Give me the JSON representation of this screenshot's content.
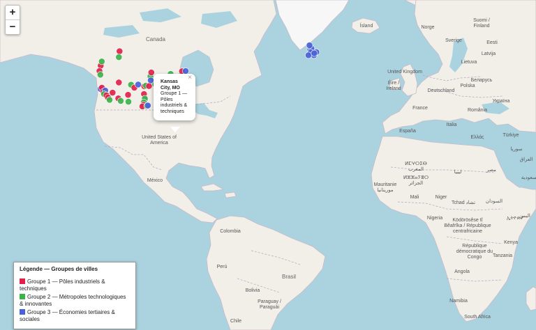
{
  "zoom": {
    "in_label": "+",
    "out_label": "−"
  },
  "popup": {
    "title": "Kansas City, MO",
    "body": "Groupe 1 — Pôles industriels & techniques",
    "close_label": "×"
  },
  "legend": {
    "title": "Légende — Groupes de villes",
    "items": [
      {
        "label": "Groupe 1 — Pôles industriels & techniques",
        "color": "#e0224b"
      },
      {
        "label": "Groupe 2 — Métropoles technologiques & innovantes",
        "color": "#3cb34a"
      },
      {
        "label": "Groupe 3 — Économies tertiaires & sociales",
        "color": "#4a62d8"
      }
    ]
  },
  "colors": {
    "ocean": "#aad3df",
    "land": "#f2efe9"
  },
  "places": {
    "canada": "Canada",
    "usa": "United States of America",
    "mexico": "México",
    "colombia": "Colombia",
    "peru": "Perú",
    "brasil": "Brasil",
    "bolivia": "Bolivia",
    "paraguay": "Paraguay / Paraguái",
    "chile": "Chile",
    "island": "Ísland",
    "uk": "United Kingdom",
    "ireland": "Éire / Ireland",
    "norge": "Norge",
    "sverige": "Sverige",
    "suomi": "Suomi / Finland",
    "eesti": "Eesti",
    "latvija": "Latvija",
    "lietuva": "Lietuva",
    "belarus": "Беларусь",
    "deutschland": "Deutschland",
    "polska": "Polska",
    "ukraina": "Україна",
    "france": "France",
    "romania": "România",
    "espana": "España",
    "italia": "Italia",
    "ellas": "Ελλάς",
    "turkiye": "Türkiye",
    "suriya": "سوريا",
    "iraq": "العراق",
    "maroc": "ⵍⵎⵖⵔⵉⴱ المغرب",
    "algerie": "ⵍⵣⵣⴰⵢⴻⵔ الجزائر",
    "libya": "ليبيا",
    "misr": "مصر",
    "mauritanie": "Mauritanie موريتانيا",
    "mali": "Mali",
    "niger": "Niger",
    "tchad": "Tchad تشاد",
    "sudan": "السودان",
    "ethiopia": "ኢትዮጵያ",
    "nigeria": "Nigeria",
    "car": "Ködörösêse tî Bêafrîka / République centrafricaine",
    "rdc": "République démocratique du Congo",
    "kenya": "Kenya",
    "tanzania": "Tanzania",
    "angola": "Angola",
    "namibia": "Namibia",
    "southafrica": "South Africa",
    "saudi": "السعودية",
    "yemen": "اليمن"
  },
  "markers": [
    {
      "group": 1,
      "lon": -122.3,
      "lat": 47.6
    },
    {
      "group": 1,
      "lon": -123.0,
      "lat": 45.5
    },
    {
      "group": 2,
      "lon": -122.5,
      "lat": 44.0
    },
    {
      "group": 2,
      "lon": -121.7,
      "lat": 49.2
    },
    {
      "group": 3,
      "lon": -122.4,
      "lat": 37.8
    },
    {
      "group": 1,
      "lon": -121.6,
      "lat": 38.4
    },
    {
      "group": 1,
      "lon": -120.8,
      "lat": 36.6
    },
    {
      "group": 3,
      "lon": -119.7,
      "lat": 37.1
    },
    {
      "group": 2,
      "lon": -120.4,
      "lat": 35.5
    },
    {
      "group": 1,
      "lon": -119.0,
      "lat": 34.9
    },
    {
      "group": 1,
      "lon": -118.1,
      "lat": 33.8
    },
    {
      "group": 2,
      "lon": -117.2,
      "lat": 32.7
    },
    {
      "group": 1,
      "lon": -115.5,
      "lat": 36.1
    },
    {
      "group": 1,
      "lon": -111.5,
      "lat": 52.9
    },
    {
      "group": 2,
      "lon": -111.9,
      "lat": 50.8
    },
    {
      "group": 1,
      "lon": -111.9,
      "lat": 40.7
    },
    {
      "group": 1,
      "lon": -112.2,
      "lat": 33.4
    },
    {
      "group": 2,
      "lon": -110.8,
      "lat": 32.2
    },
    {
      "group": 1,
      "lon": -106.6,
      "lat": 35.1
    },
    {
      "group": 2,
      "lon": -104.9,
      "lat": 39.7
    },
    {
      "group": 2,
      "lon": -106.4,
      "lat": 31.8
    },
    {
      "group": 1,
      "lon": -103.0,
      "lat": 38.4
    },
    {
      "group": 3,
      "lon": -100.8,
      "lat": 39.8
    },
    {
      "group": 1,
      "lon": -97.3,
      "lat": 39.0
    },
    {
      "group": 2,
      "lon": -96.4,
      "lat": 39.3
    },
    {
      "group": 1,
      "lon": -94.6,
      "lat": 39.1
    },
    {
      "group": 1,
      "lon": -97.5,
      "lat": 35.5
    },
    {
      "group": 1,
      "lon": -97.3,
      "lat": 32.7
    },
    {
      "group": 3,
      "lon": -96.9,
      "lat": 32.9
    },
    {
      "group": 2,
      "lon": -97.0,
      "lat": 33.3
    },
    {
      "group": 2,
      "lon": -97.6,
      "lat": 31.5
    },
    {
      "group": 1,
      "lon": -97.7,
      "lat": 30.3
    },
    {
      "group": 1,
      "lon": -98.4,
      "lat": 29.5
    },
    {
      "group": 2,
      "lon": -95.8,
      "lat": 29.7
    },
    {
      "group": 3,
      "lon": -95.3,
      "lat": 29.9
    },
    {
      "group": 2,
      "lon": -93.8,
      "lat": 43.3
    },
    {
      "group": 1,
      "lon": -93.3,
      "lat": 44.9
    },
    {
      "group": 3,
      "lon": -93.6,
      "lat": 41.6
    },
    {
      "group": 2,
      "lon": -91.0,
      "lat": 39.8
    },
    {
      "group": 1,
      "lon": -90.2,
      "lat": 38.6
    },
    {
      "group": 1,
      "lon": -89.0,
      "lat": 42.3
    },
    {
      "group": 2,
      "lon": -88.0,
      "lat": 41.8
    },
    {
      "group": 3,
      "lon": -87.9,
      "lat": 43.0
    },
    {
      "group": 1,
      "lon": -86.2,
      "lat": 39.8
    },
    {
      "group": 2,
      "lon": -85.7,
      "lat": 38.3
    },
    {
      "group": 1,
      "lon": -86.8,
      "lat": 36.2
    },
    {
      "group": 3,
      "lon": -88.0,
      "lat": 34.6
    },
    {
      "group": 1,
      "lon": -86.8,
      "lat": 33.5
    },
    {
      "group": 2,
      "lon": -84.4,
      "lat": 33.8
    },
    {
      "group": 1,
      "lon": -84.0,
      "lat": 42.3
    },
    {
      "group": 2,
      "lon": -83.0,
      "lat": 40.0
    },
    {
      "group": 2,
      "lon": -82.2,
      "lat": 44.3
    },
    {
      "group": 1,
      "lon": -81.7,
      "lat": 41.5
    },
    {
      "group": 1,
      "lon": -80.0,
      "lat": 40.4
    },
    {
      "group": 2,
      "lon": -80.8,
      "lat": 35.2
    },
    {
      "group": 1,
      "lon": -79.5,
      "lat": 37.5
    },
    {
      "group": 3,
      "lon": -78.6,
      "lat": 35.8
    },
    {
      "group": 1,
      "lon": -79.9,
      "lat": 32.8
    },
    {
      "group": 2,
      "lon": -81.0,
      "lat": 32.1
    },
    {
      "group": 3,
      "lon": -81.7,
      "lat": 30.3
    },
    {
      "group": 1,
      "lon": -82.5,
      "lat": 28.0
    },
    {
      "group": 1,
      "lon": -81.4,
      "lat": 28.5
    },
    {
      "group": 2,
      "lon": -80.6,
      "lat": 27.0
    },
    {
      "group": 3,
      "lon": -80.2,
      "lat": 25.8
    },
    {
      "group": 1,
      "lon": -77.5,
      "lat": 38.9
    },
    {
      "group": 3,
      "lon": -77.0,
      "lat": 38.9
    },
    {
      "group": 1,
      "lon": -75.2,
      "lat": 40.0
    },
    {
      "group": 2,
      "lon": -74.0,
      "lat": 40.7
    },
    {
      "group": 3,
      "lon": -73.8,
      "lat": 42.7
    },
    {
      "group": 1,
      "lon": -72.7,
      "lat": 41.8
    },
    {
      "group": 3,
      "lon": -71.1,
      "lat": 42.4
    },
    {
      "group": 1,
      "lon": -71.5,
      "lat": 41.9
    },
    {
      "group": 2,
      "lon": -76.6,
      "lat": 43.5
    },
    {
      "group": 1,
      "lon": -75.7,
      "lat": 45.4
    },
    {
      "group": 3,
      "lon": -73.6,
      "lat": 45.5
    },
    {
      "group": 3,
      "lon": -2.2,
      "lat": 53.5
    },
    {
      "group": 3,
      "lon": -1.5,
      "lat": 53.8
    },
    {
      "group": 3,
      "lon": -0.1,
      "lat": 51.5
    },
    {
      "group": 3,
      "lon": 1.3,
      "lat": 52.6
    },
    {
      "group": 3,
      "lon": -1.9,
      "lat": 52.5
    },
    {
      "group": 3,
      "lon": -3.2,
      "lat": 51.5
    },
    {
      "group": 3,
      "lon": -2.6,
      "lat": 54.9
    },
    {
      "group": 3,
      "lon": 0.1,
      "lat": 52.2
    }
  ]
}
